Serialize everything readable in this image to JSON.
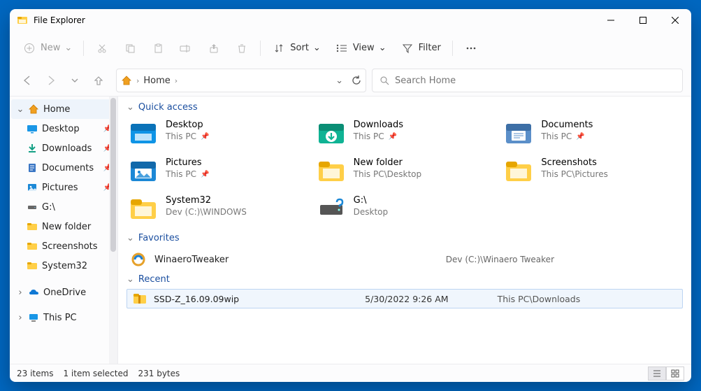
{
  "window": {
    "title": "File Explorer"
  },
  "toolbar": {
    "new_label": "New",
    "sort_label": "Sort",
    "view_label": "View",
    "filter_label": "Filter"
  },
  "address": {
    "crumb1": "Home",
    "refresh_title": "Refresh"
  },
  "search": {
    "placeholder": "Search Home"
  },
  "sidebar": {
    "home": "Home",
    "desktop": "Desktop",
    "downloads": "Downloads",
    "documents": "Documents",
    "pictures": "Pictures",
    "g_drive": "G:\\",
    "new_folder": "New folder",
    "screenshots": "Screenshots",
    "system32": "System32",
    "onedrive": "OneDrive",
    "this_pc": "This PC"
  },
  "sections": {
    "quick_access": "Quick access",
    "favorites": "Favorites",
    "recent": "Recent"
  },
  "quick_access": [
    {
      "name": "Desktop",
      "sub": "This PC",
      "pinned": true,
      "icon": "desktop"
    },
    {
      "name": "Downloads",
      "sub": "This PC",
      "pinned": true,
      "icon": "downloads"
    },
    {
      "name": "Documents",
      "sub": "This PC",
      "pinned": true,
      "icon": "documents"
    },
    {
      "name": "Pictures",
      "sub": "This PC",
      "pinned": true,
      "icon": "pictures"
    },
    {
      "name": "New folder",
      "sub": "This PC\\Desktop",
      "pinned": false,
      "icon": "folder"
    },
    {
      "name": "Screenshots",
      "sub": "This PC\\Pictures",
      "pinned": false,
      "icon": "folder"
    },
    {
      "name": "System32",
      "sub": "Dev (C:)\\WINDOWS",
      "pinned": false,
      "icon": "folder"
    },
    {
      "name": "G:\\",
      "sub": "Desktop",
      "pinned": false,
      "icon": "drive"
    }
  ],
  "favorites": [
    {
      "name": "WinaeroTweaker",
      "location": "Dev (C:)\\Winaero Tweaker"
    }
  ],
  "recent": [
    {
      "name": "SSD-Z_16.09.09wip",
      "date": "5/30/2022 9:26 AM",
      "location": "This PC\\Downloads"
    }
  ],
  "status": {
    "items": "23 items",
    "selected": "1 item selected",
    "size": "231 bytes"
  }
}
